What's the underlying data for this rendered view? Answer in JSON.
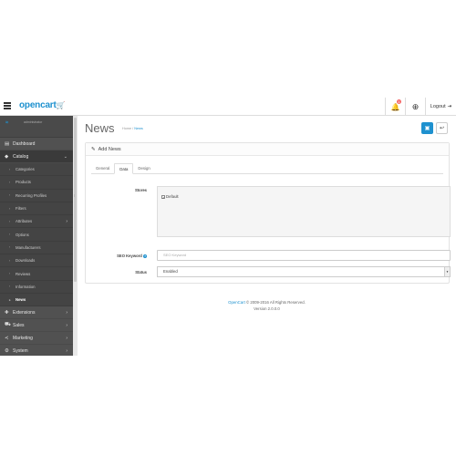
{
  "header": {
    "logo_text": "opencart",
    "logo_cart_glyph": "🛒",
    "notification_count": "1",
    "logout_label": "Logout"
  },
  "sidebar": {
    "profile_logo": "≈",
    "profile_text": "administrator",
    "items_top": [
      {
        "label": "Dashboard",
        "icon": "dashboard-icon"
      },
      {
        "label": "Catalog",
        "icon": "tag-icon"
      }
    ],
    "catalog_sub": [
      {
        "label": "Categories"
      },
      {
        "label": "Products"
      },
      {
        "label": "Recurring Profiles"
      },
      {
        "label": "Filters"
      },
      {
        "label": "Attributes"
      },
      {
        "label": "Options"
      },
      {
        "label": "Manufacturers"
      },
      {
        "label": "Downloads"
      },
      {
        "label": "Reviews"
      },
      {
        "label": "Information"
      },
      {
        "label": "News"
      }
    ],
    "items_bottom": [
      {
        "label": "Extensions",
        "icon": "puzzle-icon"
      },
      {
        "label": "Sales",
        "icon": "cart-icon"
      },
      {
        "label": "Marketing",
        "icon": "share-icon"
      },
      {
        "label": "System",
        "icon": "gear-icon"
      }
    ]
  },
  "page": {
    "title": "News",
    "breadcrumb": [
      "Home",
      "News"
    ]
  },
  "panel": {
    "title": "Add News",
    "tabs": [
      "General",
      "Data",
      "Design"
    ],
    "active_tab": "Data",
    "stores_label": "Stores",
    "store_option": "Default",
    "seo_label": "SEO Keyword",
    "seo_placeholder": "SEO Keyword",
    "status_label": "Status",
    "status_value": "Enabled"
  },
  "footer": {
    "brand": "OpenCart",
    "copyright": " © 2009-2016 All Rights Reserved.",
    "version": "Version 2.0.0.0"
  },
  "colors": {
    "accent": "#1e91cf",
    "sidebar_bg": "#515151",
    "badge": "#f56b6b"
  }
}
